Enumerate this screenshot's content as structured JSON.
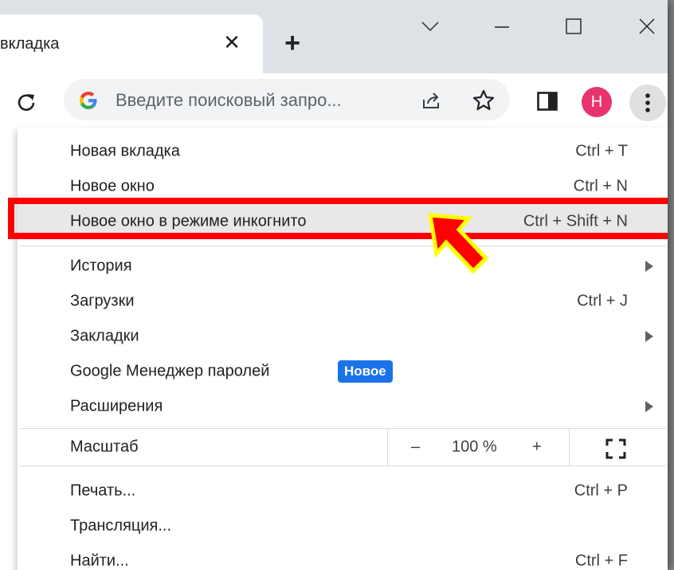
{
  "tab": {
    "title": "вкладка",
    "close": "✕",
    "new_tab": "+"
  },
  "window_controls": {
    "dropdown": "tab-search",
    "minimize": "minimize",
    "maximize": "maximize",
    "close": "close"
  },
  "toolbar": {
    "reload_icon": "reload-icon",
    "omnibox_placeholder": "Введите поисковый запро...",
    "avatar_letter": "H"
  },
  "menu": {
    "items": [
      {
        "label": "Новая вкладка",
        "shortcut": "Ctrl + T"
      },
      {
        "label": "Новое окно",
        "shortcut": "Ctrl + N"
      },
      {
        "label": "Новое окно в режиме инкогнито",
        "shortcut": "Ctrl + Shift + N"
      },
      {
        "label": "История",
        "submenu": true
      },
      {
        "label": "Загрузки",
        "shortcut": "Ctrl + J"
      },
      {
        "label": "Закладки",
        "submenu": true
      },
      {
        "label": "Google Менеджер паролей",
        "badge": "Новое"
      },
      {
        "label": "Расширения",
        "submenu": true
      }
    ],
    "zoom": {
      "label": "Масштаб",
      "minus": "–",
      "value": "100 %",
      "plus": "+"
    },
    "bottom_items": [
      {
        "label": "Печать...",
        "shortcut": "Ctrl + P"
      },
      {
        "label": "Трансляция..."
      },
      {
        "label": "Найти...",
        "shortcut": "Ctrl + F"
      }
    ]
  },
  "colors": {
    "highlight_box": "#ff0000",
    "pointer_fill": "#ff0000",
    "pointer_outline": "#ffff00",
    "badge": "#1a73e8",
    "avatar": "#e8336d"
  }
}
